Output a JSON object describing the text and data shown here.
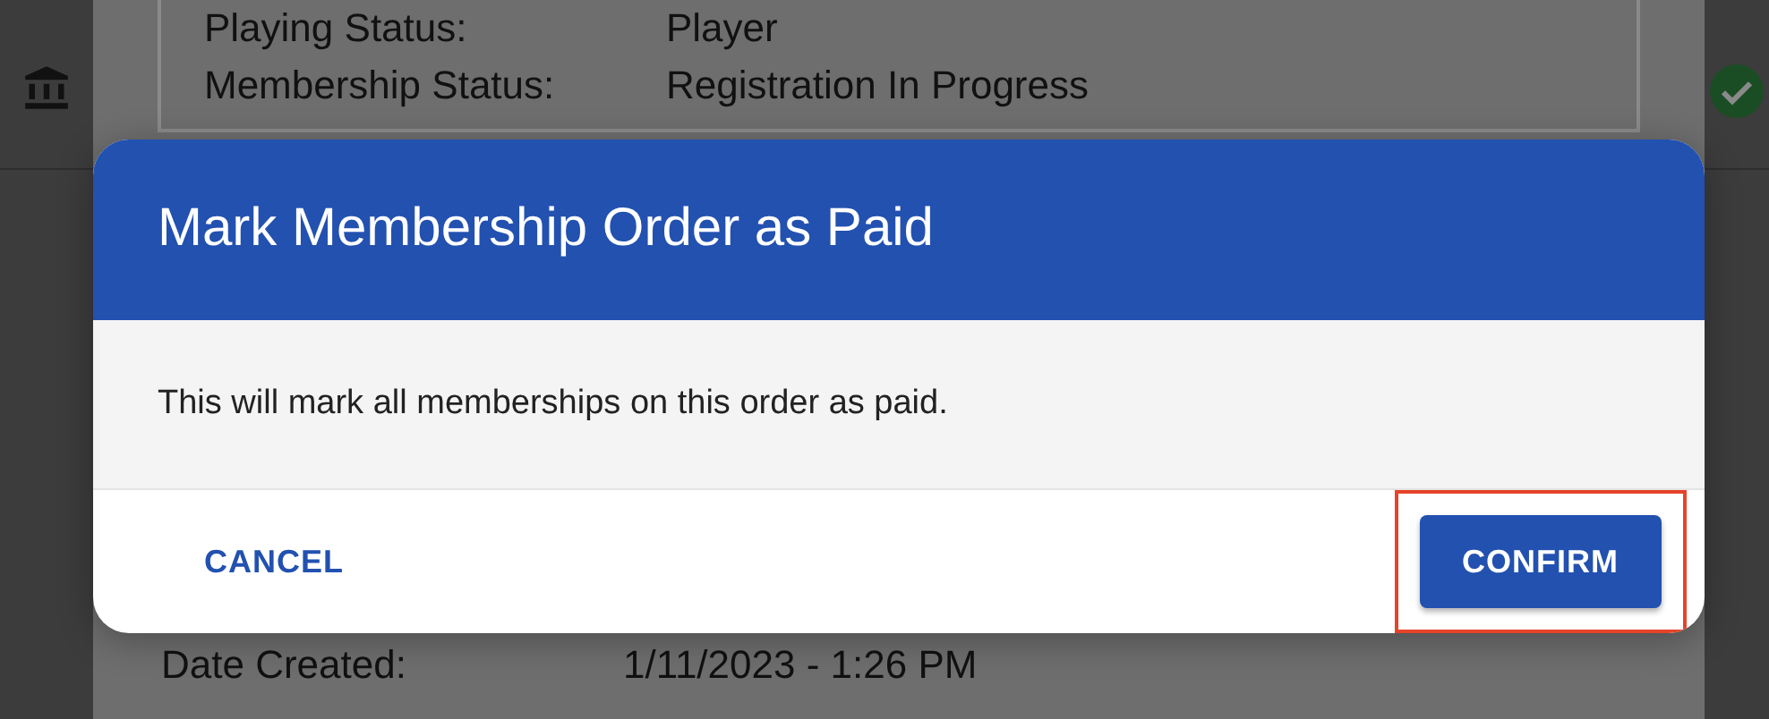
{
  "background_details": [
    {
      "label": "Playing Status:",
      "value": "Player"
    },
    {
      "label": "Membership Status:",
      "value": "Registration In Progress"
    },
    {
      "label": "Date Created:",
      "value": "1/11/2023 - 1:26 PM"
    }
  ],
  "dialog": {
    "title": "Mark Membership Order as Paid",
    "message": "This will mark all memberships on this order as paid.",
    "buttons": [
      {
        "label": "CANCEL",
        "kind": "text",
        "highlighted": false
      },
      {
        "label": "CONFIRM",
        "kind": "contained",
        "highlighted": true
      }
    ]
  }
}
